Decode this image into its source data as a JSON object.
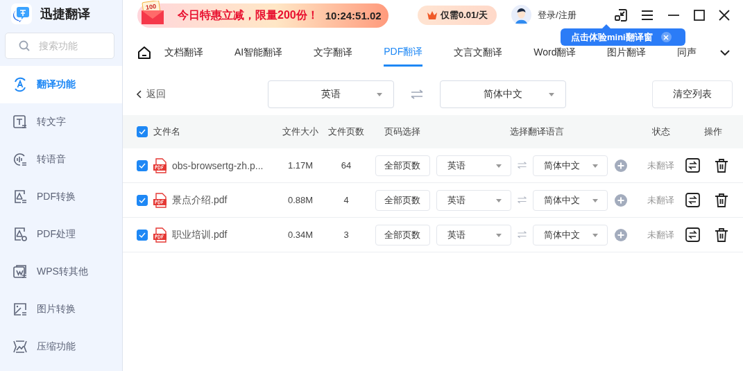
{
  "app": {
    "name": "迅捷翻译"
  },
  "search": {
    "placeholder": "搜索功能"
  },
  "sidebar": {
    "items": [
      {
        "label": "翻译功能",
        "selected": true
      },
      {
        "label": "转文字",
        "selected": false
      },
      {
        "label": "转语音",
        "selected": false
      },
      {
        "label": "PDF转换",
        "selected": false
      },
      {
        "label": "PDF处理",
        "selected": false
      },
      {
        "label": "WPS转其他",
        "selected": false
      },
      {
        "label": "图片转换",
        "selected": false
      },
      {
        "label": "压缩功能",
        "selected": false
      }
    ]
  },
  "promo": {
    "badge": "100",
    "text": "今日特惠立减，限量200份！",
    "countdown": "10:24:51.02"
  },
  "price": {
    "text": "仅需0.01/天"
  },
  "user": {
    "label": "登录/注册"
  },
  "tooltip": {
    "text": "点击体验mini翻译窗"
  },
  "tabs": [
    {
      "label": "文档翻译",
      "selected": false
    },
    {
      "label": "AI智能翻译",
      "selected": false
    },
    {
      "label": "文字翻译",
      "selected": false
    },
    {
      "label": "PDF翻译",
      "selected": true
    },
    {
      "label": "文言文翻译",
      "selected": false
    },
    {
      "label": "Word翻译",
      "selected": false
    },
    {
      "label": "图片翻译",
      "selected": false
    },
    {
      "label": "同声",
      "selected": false
    }
  ],
  "toolbar": {
    "back": "返回",
    "source": "英语",
    "target": "简体中文",
    "clear": "清空列表"
  },
  "table": {
    "all_checked": true,
    "columns": [
      "文件名",
      "文件大小",
      "文件页数",
      "页码选择",
      "选择翻译语言",
      "状态",
      "操作"
    ],
    "rows": [
      {
        "checked": true,
        "name": "obs-browsertg-zh.p...",
        "size": "1.17M",
        "pages": "64",
        "page_select": "全部页数",
        "source": "英语",
        "target": "简体中文",
        "status": "未翻译"
      },
      {
        "checked": true,
        "name": "景点介绍.pdf",
        "size": "0.88M",
        "pages": "4",
        "page_select": "全部页数",
        "source": "英语",
        "target": "简体中文",
        "status": "未翻译"
      },
      {
        "checked": true,
        "name": "职业培训.pdf",
        "size": "0.34M",
        "pages": "3",
        "page_select": "全部页数",
        "source": "英语",
        "target": "简体中文",
        "status": "未翻译"
      }
    ]
  }
}
